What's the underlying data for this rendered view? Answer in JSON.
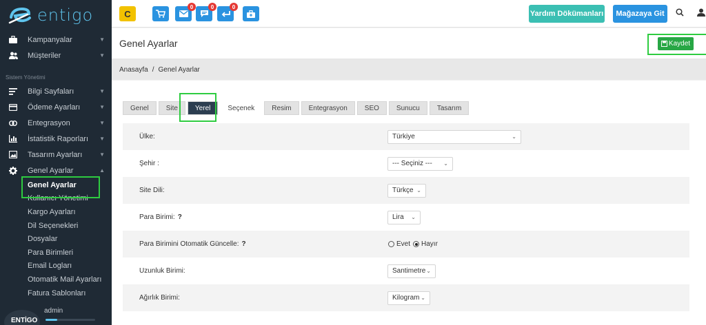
{
  "brand": {
    "name": "entigo"
  },
  "sidebar": {
    "main_items": [
      {
        "label": "Kampanyalar",
        "icon": "briefcase-icon"
      },
      {
        "label": "Müşteriler",
        "icon": "users-icon"
      }
    ],
    "section_title": "Sistem Yönetimi",
    "system_items": [
      {
        "label": "Bilgi Sayfaları",
        "icon": "lines-icon"
      },
      {
        "label": "Ödeme Ayarları",
        "icon": "credit-card-icon"
      },
      {
        "label": "Entegrasyon",
        "icon": "link-icon"
      },
      {
        "label": "İstatistik Raporları",
        "icon": "bar-chart-icon"
      },
      {
        "label": "Tasarım Ayarları",
        "icon": "image-icon"
      },
      {
        "label": "Genel Ayarlar",
        "icon": "gear-icon"
      }
    ],
    "sub_items": [
      "Genel Ayarlar",
      "Kullanıcı Yönetimi",
      "Kargo Ayarları",
      "Dil Seçenekleri",
      "Dosyalar",
      "Para Birimleri",
      "Email Logları",
      "Otomatik Mail Ayarları",
      "Fatura Sablonları"
    ],
    "footer": {
      "avatar_text": "ENTİGO",
      "user": "admin",
      "progress": 0.24
    }
  },
  "topbar": {
    "buttons": [
      {
        "icon": "refresh-icon",
        "badge": ""
      },
      {
        "icon": "cart-icon",
        "badge": ""
      },
      {
        "icon": "mail-icon",
        "badge": "0"
      },
      {
        "icon": "comment-icon",
        "badge": "0"
      },
      {
        "icon": "reply-icon",
        "badge": "0"
      },
      {
        "icon": "briefcase-icon",
        "badge": ""
      }
    ],
    "help_label": "Yardım Dökümanları",
    "store_label": "Mağazaya Git"
  },
  "page": {
    "title": "Genel Ayarlar",
    "save_label": "Kaydet",
    "breadcrumb": [
      "Anasayfa",
      "/",
      "Genel Ayarlar"
    ]
  },
  "tabs": [
    "Genel",
    "Site",
    "Yerel",
    "Seçenek",
    "Resim",
    "Entegrasyon",
    "SEO",
    "Sunucu",
    "Tasarım"
  ],
  "active_tab": "Yerel",
  "form": {
    "country": {
      "label": "Ülke:",
      "value": "Türkiye"
    },
    "city": {
      "label": "Şehir :",
      "value": "--- Seçiniz ---"
    },
    "language": {
      "label": "Site Dili:",
      "value": "Türkçe"
    },
    "currency": {
      "label": "Para Birimi:",
      "help": "?",
      "value": "Lira"
    },
    "auto_update": {
      "label": "Para Birimini Otomatik Güncelle:",
      "help": "?",
      "yes": "Evet",
      "no": "Hayır",
      "selected": "Hayır"
    },
    "length": {
      "label": "Uzunluk Birimi:",
      "value": "Santimetre"
    },
    "weight": {
      "label": "Ağırlık Birimi:",
      "value": "Kilogram"
    }
  },
  "colors": {
    "sidebar": "#1f2a35",
    "accent": "#2a93e0",
    "teal": "#3bbfb3",
    "save": "#28a745",
    "highlight": "#2ecc40"
  }
}
